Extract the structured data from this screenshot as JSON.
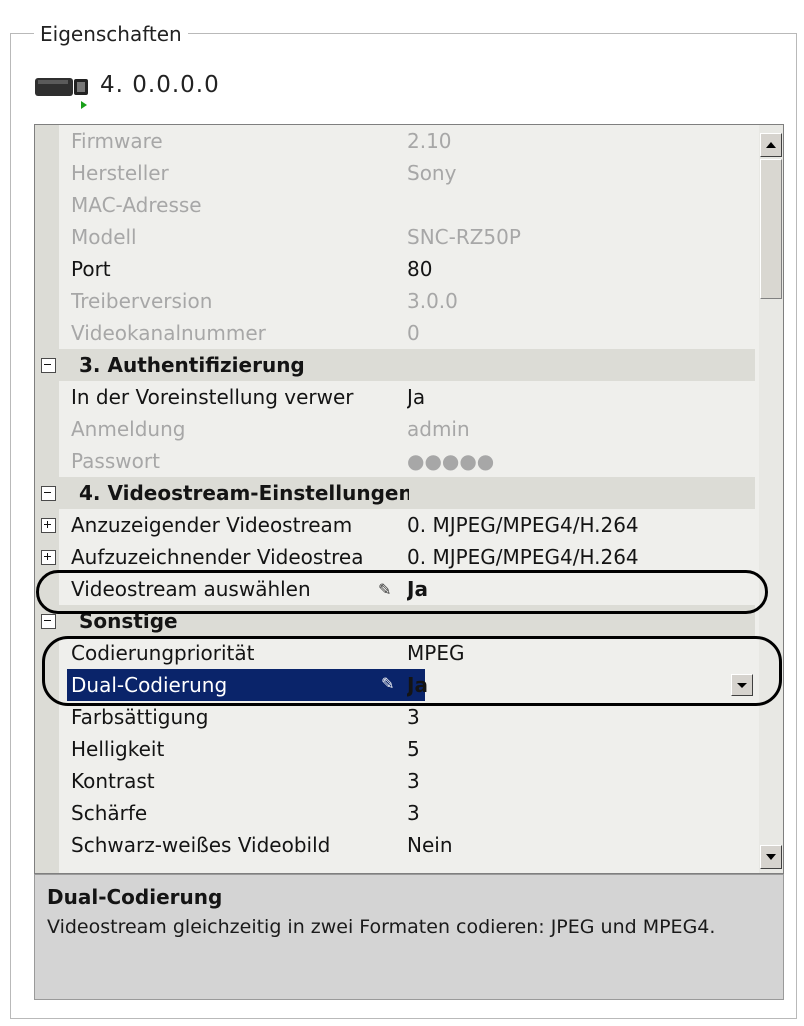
{
  "panel": {
    "title": "Eigenschaften"
  },
  "device": {
    "icon": "camera-icon",
    "label": "4. 0.0.0.0"
  },
  "grid": {
    "rows": [
      {
        "kind": "prop",
        "state": "dim",
        "name": "Firmware",
        "value": "2.10"
      },
      {
        "kind": "prop",
        "state": "dim",
        "name": "Hersteller",
        "value": "Sony"
      },
      {
        "kind": "prop",
        "state": "dim",
        "name": "MAC-Adresse",
        "value": ""
      },
      {
        "kind": "prop",
        "state": "dim",
        "name": "Modell",
        "value": "SNC-RZ50P"
      },
      {
        "kind": "prop",
        "state": "norm",
        "name": "Port",
        "value": "80"
      },
      {
        "kind": "prop",
        "state": "dim",
        "name": "Treiberversion",
        "value": "3.0.0"
      },
      {
        "kind": "prop",
        "state": "dim",
        "name": "Videokanalnummer",
        "value": "0"
      },
      {
        "kind": "cat",
        "toggle": "minus",
        "name": "3. Authentifizierung"
      },
      {
        "kind": "prop",
        "state": "norm",
        "name": "In der Voreinstellung verwer",
        "value": "Ja"
      },
      {
        "kind": "prop",
        "state": "dim",
        "name": "Anmeldung",
        "value": "admin"
      },
      {
        "kind": "prop",
        "state": "dim",
        "name": "Passwort",
        "value": "●●●●●"
      },
      {
        "kind": "cat",
        "toggle": "minus",
        "name": "4. Videostream-Einstellungen"
      },
      {
        "kind": "prop",
        "state": "norm",
        "toggle": "plus",
        "name": "Anzuzeigender Videostream",
        "value": "0. MJPEG/MPEG4/H.264"
      },
      {
        "kind": "prop",
        "state": "norm",
        "toggle": "plus",
        "name": "Aufzuzeichnender Videostrea",
        "value": "0. MJPEG/MPEG4/H.264"
      },
      {
        "kind": "prop",
        "state": "norm",
        "bold": true,
        "edit": true,
        "name": "Videostream auswählen",
        "value": "Ja"
      },
      {
        "kind": "cat",
        "toggle": "minus",
        "name": "Sonstige"
      },
      {
        "kind": "prop",
        "state": "norm",
        "name": "Codierungpriorität",
        "value": "MPEG"
      },
      {
        "kind": "prop",
        "state": "norm",
        "selected": true,
        "edit": true,
        "dropdown": true,
        "name": "Dual-Codierung",
        "value": "Ja"
      },
      {
        "kind": "prop",
        "state": "norm",
        "name": "Farbsättigung",
        "value": "3"
      },
      {
        "kind": "prop",
        "state": "norm",
        "name": "Helligkeit",
        "value": "5"
      },
      {
        "kind": "prop",
        "state": "norm",
        "name": "Kontrast",
        "value": "3"
      },
      {
        "kind": "prop",
        "state": "norm",
        "name": "Schärfe",
        "value": "3"
      },
      {
        "kind": "prop",
        "state": "norm",
        "name": "Schwarz-weißes Videobild",
        "value": "Nein"
      }
    ]
  },
  "description": {
    "title": "Dual-Codierung",
    "text": "Videostream gleichzeitig in zwei Formaten codieren: JPEG und MPEG4."
  },
  "colors": {
    "selection": "#0a246a",
    "category_bg": "#dcdcd6",
    "disabled_text": "#a7a7a7"
  }
}
